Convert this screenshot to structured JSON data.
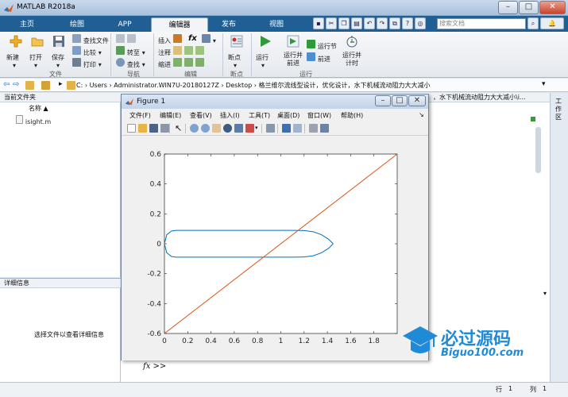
{
  "window": {
    "title": "MATLAB R2018a",
    "min": "–",
    "max": "□",
    "close": "✕"
  },
  "tabs": [
    "主页",
    "绘图",
    "APP",
    "编辑器",
    "发布",
    "视图"
  ],
  "search": {
    "placeholder": "搜索文档"
  },
  "ribbon": {
    "file": {
      "new": "新建",
      "open": "打开",
      "save": "保存",
      "find_files": "查找文件",
      "compare": "比较",
      "print": "打印",
      "group": "文件"
    },
    "navigate": {
      "goto": "转至",
      "find": "查找",
      "group": "导航"
    },
    "edit": {
      "insert": "插入",
      "fx": "fx",
      "comment": "注释",
      "indent": "缩进",
      "group": "编辑"
    },
    "breakpoints": {
      "label": "断点",
      "group": "断点"
    },
    "run": {
      "run": "运行",
      "run_advance": "运行并\n前进",
      "run_section": "运行节",
      "advance": "前进",
      "run_time": "运行并\n计时",
      "group": "运行"
    }
  },
  "address": {
    "path": "C: › Users › Administrator.WIN7U-20180127Z › Desktop › 格兰维尔流线型设计，优化设计，水下机械流动阻力大大减小"
  },
  "current_folder": {
    "title": "当前文件夹",
    "column": "名称 ▲",
    "files": [
      "isight.m"
    ]
  },
  "details": {
    "title": "详细信息",
    "hint": "选择文件以查看详细信息"
  },
  "command": {
    "header": "，水下机械流动阻力大大减小\\i...",
    "prompt": "fx >>"
  },
  "workspace": {
    "label": "工作区"
  },
  "status": {
    "row_label": "行",
    "row": "1",
    "col_label": "列",
    "col": "1"
  },
  "figure": {
    "title": "Figure 1",
    "menus": [
      "文件(F)",
      "编辑(E)",
      "查看(V)",
      "插入(I)",
      "工具(T)",
      "桌面(D)",
      "窗口(W)",
      "帮助(H)"
    ]
  },
  "chart_data": {
    "type": "line",
    "xlim": [
      0,
      2
    ],
    "ylim": [
      -0.6,
      0.6
    ],
    "xticks": [
      "0",
      "0.2",
      "0.4",
      "0.6",
      "0.8",
      "1",
      "1.2",
      "1.4",
      "1.6",
      "1.8"
    ],
    "yticks": [
      "-0.6",
      "-0.4",
      "-0.2",
      "0",
      "0.2",
      "0.4",
      "0.6"
    ],
    "series": [
      {
        "color": "#0072bd",
        "points": [
          [
            0,
            0
          ],
          [
            0.02,
            0.06
          ],
          [
            0.06,
            0.085
          ],
          [
            0.1,
            0.09
          ],
          [
            0.3,
            0.09
          ],
          [
            0.6,
            0.09
          ],
          [
            0.9,
            0.09
          ],
          [
            1.1,
            0.09
          ],
          [
            1.2,
            0.088
          ],
          [
            1.28,
            0.08
          ],
          [
            1.35,
            0.06
          ],
          [
            1.41,
            0.03
          ],
          [
            1.45,
            0
          ]
        ]
      },
      {
        "color": "#0072bd",
        "points": [
          [
            0,
            0
          ],
          [
            0.02,
            -0.06
          ],
          [
            0.06,
            -0.085
          ],
          [
            0.1,
            -0.09
          ],
          [
            0.3,
            -0.09
          ],
          [
            0.6,
            -0.09
          ],
          [
            0.9,
            -0.09
          ],
          [
            1.1,
            -0.09
          ],
          [
            1.2,
            -0.088
          ],
          [
            1.28,
            -0.08
          ],
          [
            1.35,
            -0.06
          ],
          [
            1.41,
            -0.03
          ],
          [
            1.45,
            0
          ]
        ]
      },
      {
        "color": "#d95319",
        "points": [
          [
            0,
            -0.6
          ],
          [
            2,
            0.6
          ]
        ]
      }
    ]
  },
  "watermark": {
    "brand": "必过源码",
    "url": "Biguo100.com"
  }
}
